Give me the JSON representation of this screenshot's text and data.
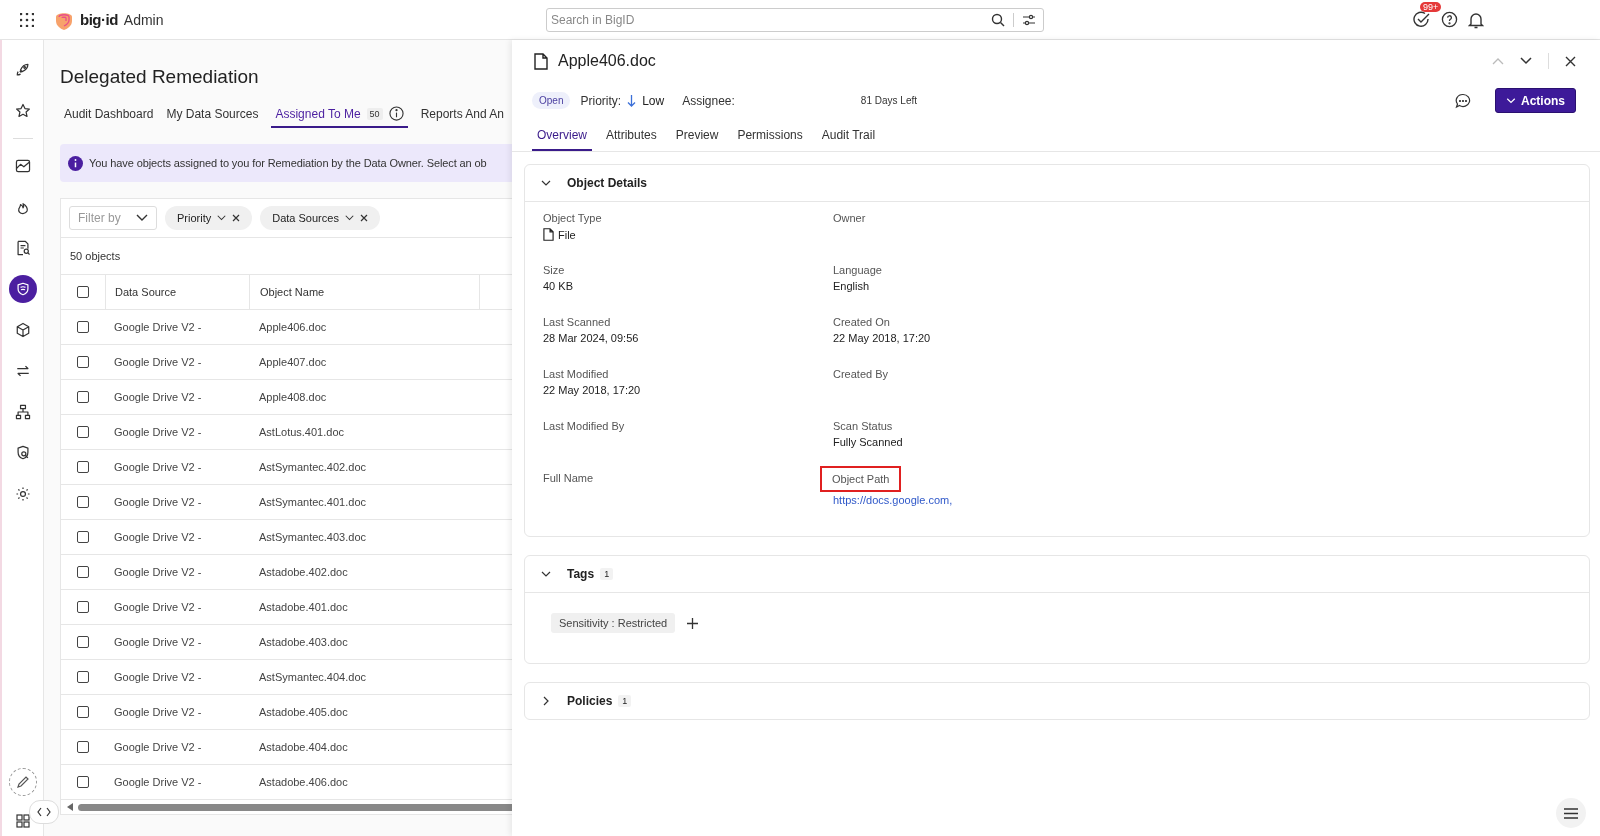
{
  "topbar": {
    "brand": "big·id",
    "product": "Admin",
    "search": {
      "placeholder": "Search in BigID"
    },
    "badge": "99+"
  },
  "sidebar": {
    "items": [
      {
        "selected": false
      },
      {
        "selected": false
      },
      {
        "selected": false
      },
      {
        "selected": false
      },
      {
        "selected": false
      },
      {
        "selected": true
      },
      {
        "selected": false
      },
      {
        "selected": false
      },
      {
        "selected": false
      },
      {
        "selected": false
      },
      {
        "selected": false
      }
    ]
  },
  "page": {
    "title": "Delegated Remediation",
    "tabs": [
      {
        "label": "Audit Dashboard",
        "selected": false
      },
      {
        "label": "My Data Sources",
        "selected": false
      },
      {
        "label": "Assigned To Me",
        "count": "50",
        "selected": true
      },
      {
        "label": "Reports And An",
        "selected": false
      }
    ],
    "banner": "You have objects assigned to you for Remediation by the Data Owner. Select an ob",
    "filter": {
      "placeholder": "Filter by"
    },
    "chips": [
      "Priority",
      "Data Sources"
    ],
    "count": "50 objects",
    "table": {
      "all_checked": false,
      "columns": [
        "Data Source",
        "Object Name"
      ],
      "rows": [
        {
          "data_source": "Google Drive V2 -",
          "object_name": "Apple406.doc",
          "checked": false
        },
        {
          "data_source": "Google Drive V2 -",
          "object_name": "Apple407.doc",
          "checked": false
        },
        {
          "data_source": "Google Drive V2 -",
          "object_name": "Apple408.doc",
          "checked": false
        },
        {
          "data_source": "Google Drive V2 -",
          "object_name": "AstLotus.401.doc",
          "checked": false
        },
        {
          "data_source": "Google Drive V2 -",
          "object_name": "AstSymantec.402.doc",
          "checked": false
        },
        {
          "data_source": "Google Drive V2 -",
          "object_name": "AstSymantec.401.doc",
          "checked": false
        },
        {
          "data_source": "Google Drive V2 -",
          "object_name": "AstSymantec.403.doc",
          "checked": false
        },
        {
          "data_source": "Google Drive V2 -",
          "object_name": "Astadobe.402.doc",
          "checked": false
        },
        {
          "data_source": "Google Drive V2 -",
          "object_name": "Astadobe.401.doc",
          "checked": false
        },
        {
          "data_source": "Google Drive V2 -",
          "object_name": "Astadobe.403.doc",
          "checked": false
        },
        {
          "data_source": "Google Drive V2 -",
          "object_name": "AstSymantec.404.doc",
          "checked": false
        },
        {
          "data_source": "Google Drive V2 -",
          "object_name": "Astadobe.405.doc",
          "checked": false
        },
        {
          "data_source": "Google Drive V2 -",
          "object_name": "Astadobe.404.doc",
          "checked": false
        },
        {
          "data_source": "Google Drive V2 -",
          "object_name": "Astadobe.406.doc",
          "checked": false
        }
      ]
    }
  },
  "detail": {
    "title": "Apple406.doc",
    "status": "Open",
    "priority_label": "Priority:",
    "priority": "Low",
    "assignee_label": "Assignee:",
    "days_left": "81 Days Left",
    "actions": "Actions",
    "tabs": [
      {
        "label": "Overview",
        "selected": true
      },
      {
        "label": "Attributes",
        "selected": false
      },
      {
        "label": "Preview",
        "selected": false
      },
      {
        "label": "Permissions",
        "selected": false
      },
      {
        "label": "Audit Trail",
        "selected": false
      }
    ],
    "object_details": {
      "title": "Object Details",
      "expanded": true,
      "fields": [
        {
          "label": "Object Type",
          "value": "File",
          "kind": "file"
        },
        {
          "label": "Owner"
        },
        {
          "label": "Size",
          "value": "40 KB",
          "kind": "text"
        },
        {
          "label": "Language",
          "value": "English",
          "kind": "text"
        },
        {
          "label": "Last Scanned",
          "value": "28 Mar 2024, 09:56",
          "kind": "text"
        },
        {
          "label": "Created On",
          "value": "22 May 2018, 17:20",
          "kind": "text"
        },
        {
          "label": "Last Modified",
          "value": "22 May 2018, 17:20",
          "kind": "text"
        },
        {
          "label": "Created By"
        },
        {
          "label": "Last Modified By"
        },
        {
          "label": "Scan Status",
          "value": "Fully Scanned",
          "kind": "text"
        },
        {
          "label": "Full Name"
        },
        {
          "label": "Object Path",
          "value": "https://docs.google.com,",
          "kind": "link",
          "highlighted": true
        }
      ]
    },
    "tags": {
      "title": "Tags",
      "count": "1",
      "expanded": true,
      "items": [
        "Sensitivity : Restricted"
      ]
    },
    "policies": {
      "title": "Policies",
      "count": "1",
      "expanded": false
    }
  }
}
